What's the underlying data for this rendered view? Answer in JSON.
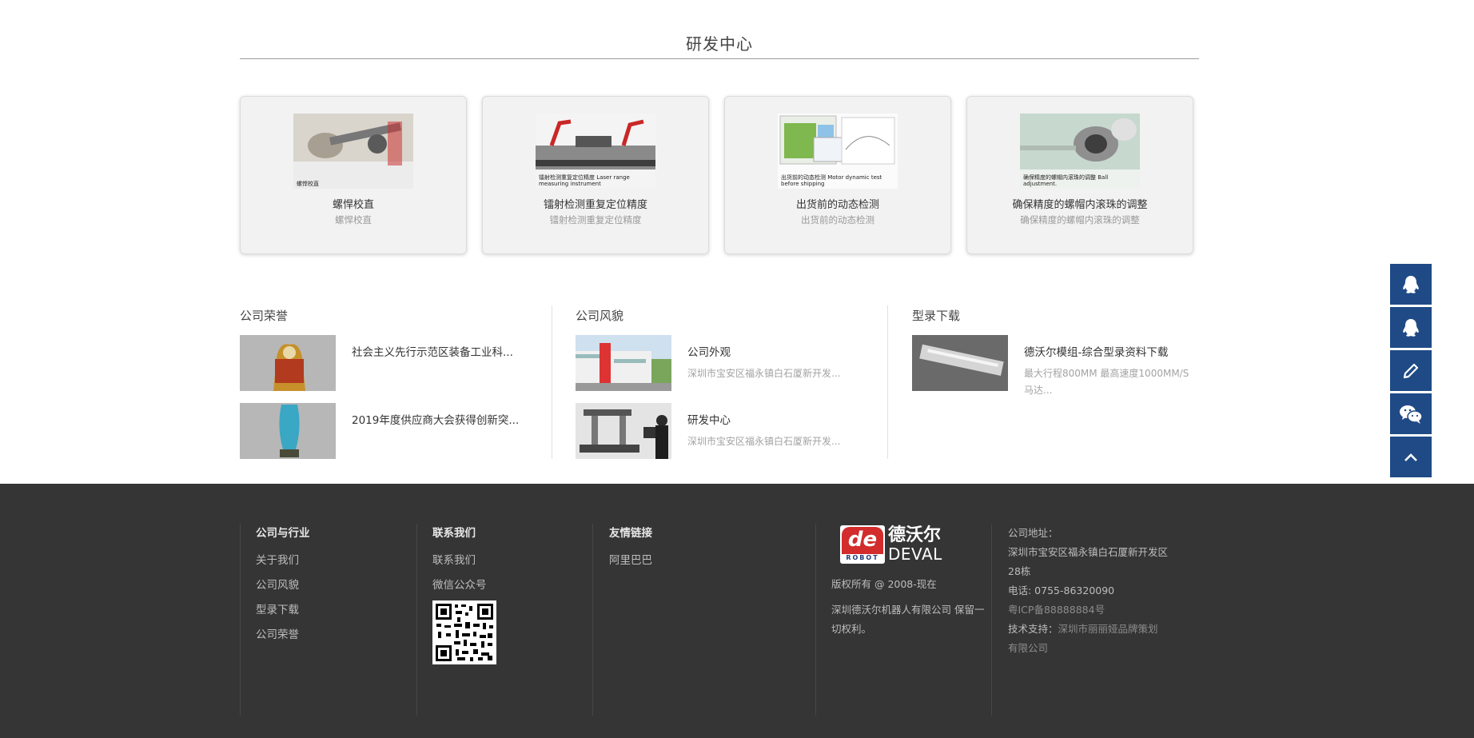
{
  "rd_section": {
    "title": "研发中心",
    "cards": [
      {
        "title": "螺悍校直",
        "subtitle": "螺悍校直",
        "caption": "螺悍校直"
      },
      {
        "title": "镭射检测重复定位精度",
        "subtitle": "镭射检测重复定位精度",
        "caption": "镭射检测重复定位精度 Laser range measuring instrument"
      },
      {
        "title": "出货前的动态检测",
        "subtitle": "出货前的动态检测",
        "caption": "出货前的动态检测 Motor dynamic test before shipping"
      },
      {
        "title": "确保精度的螺帽内滚珠的调整",
        "subtitle": "确保精度的螺帽内滚珠的调整",
        "caption": "确保精度的螺帽内滚珠的调整 Ball adjustment."
      }
    ]
  },
  "honors": {
    "heading": "公司荣誉",
    "items": [
      {
        "title": "社会主义先行示范区装备工业科..."
      },
      {
        "title": "2019年度供应商大会获得创新突..."
      }
    ]
  },
  "style": {
    "heading": "公司风貌",
    "items": [
      {
        "title": "公司外观",
        "desc": "深圳市宝安区福永镇白石厦新开发..."
      },
      {
        "title": "研发中心",
        "desc": "深圳市宝安区福永镇白石厦新开发..."
      }
    ]
  },
  "catalog": {
    "heading": "型录下载",
    "items": [
      {
        "title": "德沃尔模组-综合型录资料下载",
        "desc": "最大行程800MM 最高速度1000MM/S 马达..."
      }
    ]
  },
  "float_bar": {
    "icons": [
      "qq-icon",
      "qq-icon",
      "edit-icon",
      "wechat-icon",
      "arrow-up-icon"
    ],
    "color": "#1f4a86"
  },
  "footer": {
    "col1": {
      "heading": "公司与行业",
      "links": [
        "关于我们",
        "公司风貌",
        "型录下载",
        "公司荣誉"
      ]
    },
    "col2": {
      "heading": "联系我们",
      "links": [
        "联系我们",
        "微信公众号"
      ]
    },
    "col3": {
      "heading": "友情链接",
      "links": [
        "阿里巴巴"
      ]
    },
    "brand": {
      "logo_mark": "de",
      "logo_sub": "ROBOT",
      "logo_cn": "德沃尔",
      "logo_en": "DEVAL",
      "copyright": "版权所有 @ 2008-现在",
      "rights": "深圳德沃尔机器人有限公司 保留一切权利。"
    },
    "contact": {
      "address_label": "公司地址：",
      "address": "深圳市宝安区福永镇白石厦新开发区28栋",
      "phone": "电话: 0755-86320090",
      "icp": "粤ICP备88888884号",
      "support_label": "技术支持：",
      "support": "深圳市丽丽娅品牌策划有限公司"
    }
  }
}
